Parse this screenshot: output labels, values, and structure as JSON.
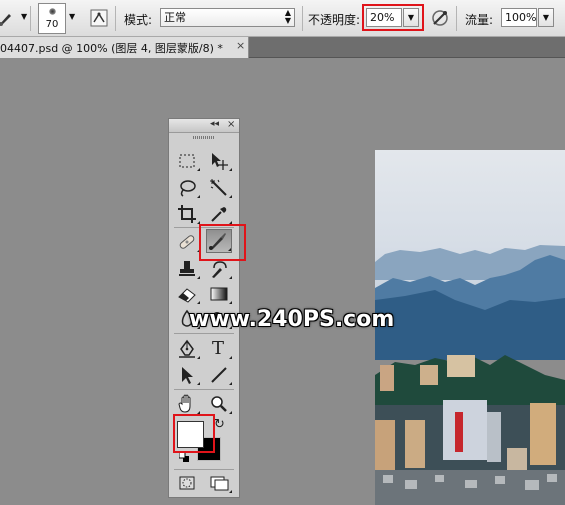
{
  "options_bar": {
    "brush_size": "70",
    "mode_label": "模式:",
    "mode_value": "正常",
    "opacity_label": "不透明度:",
    "opacity_value": "20%",
    "flow_label": "流量:",
    "flow_value": "100%"
  },
  "document_tab": {
    "title": "04407.psd @ 100% (图层 4, 图层蒙版/8) *",
    "close_glyph": "×"
  },
  "tools_panel": {
    "collapse_glyph": "◂◂",
    "close_glyph": "×",
    "tools": [
      "rectangular-marquee-tool",
      "move-tool",
      "lasso-tool",
      "magic-wand-tool",
      "crop-tool",
      "eyedropper-tool",
      "spot-healing-brush-tool",
      "brush-tool",
      "clone-stamp-tool",
      "history-brush-tool",
      "eraser-tool",
      "gradient-tool",
      "blur-tool",
      "dodge-tool",
      "pen-tool",
      "type-tool",
      "path-selection-tool",
      "line-tool",
      "hand-tool",
      "zoom-tool"
    ],
    "active_tool": "brush-tool",
    "type_tool_glyph": "T",
    "foreground_color": "#ffffff",
    "background_color": "#000000",
    "swap_glyph": "↻"
  },
  "highlight_color": "#e0141a",
  "watermark": "www.240PS.com"
}
